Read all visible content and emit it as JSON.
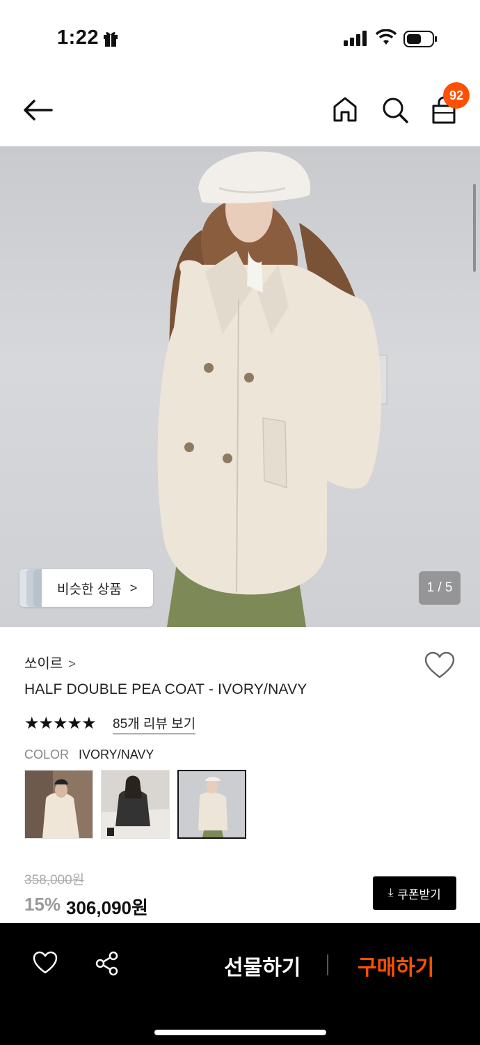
{
  "status_bar": {
    "time": "1:22"
  },
  "header": {
    "cart_count": "92"
  },
  "gallery": {
    "similar_label": "비슷한 상품",
    "similar_chevron": ">",
    "page_indicator": "1 / 5"
  },
  "product": {
    "brand": "쏘이르",
    "brand_chevron": ">",
    "name": "HALF DOUBLE PEA COAT - IVORY/NAVY",
    "stars": "★★★★★",
    "rating": 5,
    "review_link": "85개 리뷰 보기",
    "color_label": "COLOR",
    "color_value": "IVORY/NAVY",
    "original_price": "358,000원",
    "discount": "15%",
    "sale_price": "306,090원",
    "coupon_label": "쿠폰받기"
  },
  "bottom_bar": {
    "gift_label": "선물하기",
    "buy_label": "구매하기"
  },
  "colors": {
    "accent": "#ff4f00",
    "black": "#000000"
  }
}
